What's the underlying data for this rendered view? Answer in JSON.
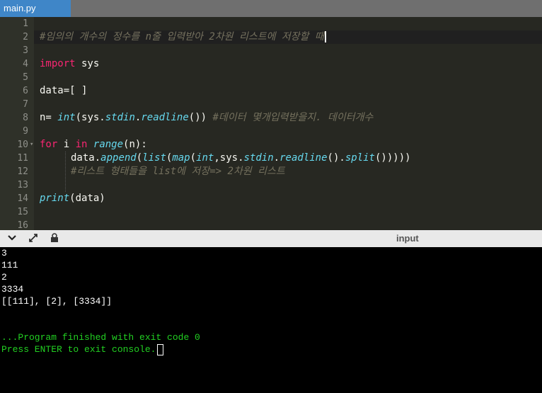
{
  "tab": {
    "filename": "main.py"
  },
  "editor": {
    "line_numbers": [
      "1",
      "2",
      "3",
      "4",
      "5",
      "6",
      "7",
      "8",
      "9",
      "10",
      "11",
      "12",
      "13",
      "14",
      "15",
      "16"
    ],
    "l2_comment": "#임의의 개수의 정수를 n줄 입력받아 2차원 리스트에 저장할 때",
    "l4_import": "import",
    "l4_mod": " sys",
    "l6_code": "data=[ ]",
    "l8_a": "n= ",
    "l8_int": "int",
    "l8_b": "(sys.",
    "l8_stdin": "stdin",
    "l8_c": ".",
    "l8_readline": "readline",
    "l8_d": "()) ",
    "l8_comment": "#데이터 몇개입력받을지. 데이터개수",
    "l10_for": "for",
    "l10_i": " i ",
    "l10_in": "in",
    "l10_sp": " ",
    "l10_range": "range",
    "l10_rest": "(n):",
    "l11_a": "data.",
    "l11_append": "append",
    "l11_b": "(",
    "l11_list": "list",
    "l11_c": "(",
    "l11_map": "map",
    "l11_d": "(",
    "l11_int": "int",
    "l11_e": ",sys.",
    "l11_stdin": "stdin",
    "l11_f": ".",
    "l11_readline": "readline",
    "l11_g": "().",
    "l11_split": "split",
    "l11_h": "()))))",
    "l12_comment": "#리스트 형태들을 list에 저장=> 2차원 리스트",
    "l14_print": "print",
    "l14_rest": "(data)"
  },
  "panel": {
    "input_label": "input"
  },
  "console": {
    "lines": [
      "3",
      "111",
      "2",
      "3334",
      "[[111], [2], [3334]]"
    ],
    "finished": "...Program finished with exit code 0",
    "press_enter": "Press ENTER to exit console."
  },
  "icons": {
    "collapse": "chevron-down-icon",
    "expand": "expand-arrows-icon",
    "settings": "settings-icon"
  },
  "colors": {
    "tab_active": "#3f86c8",
    "console_green": "#22d022",
    "editor_bg": "#272822"
  }
}
